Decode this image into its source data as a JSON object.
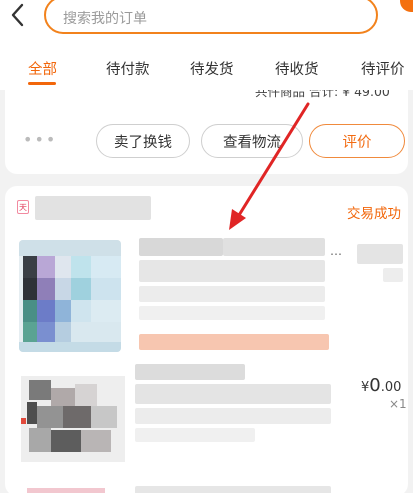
{
  "search": {
    "placeholder": "搜索我的订单"
  },
  "tabs": [
    {
      "label": "全部",
      "active": true
    },
    {
      "label": "待付款"
    },
    {
      "label": "待发货"
    },
    {
      "label": "待收货"
    },
    {
      "label": "待评价"
    }
  ],
  "prev_order": {
    "summary_text": "共件商品 合计: ¥ 49.00",
    "actions": {
      "sell": "卖了换钱",
      "logistics": "查看物流",
      "review": "评价"
    }
  },
  "order": {
    "status": "交易成功",
    "shop_badge": "天",
    "item2": {
      "price_symbol": "¥",
      "price_int": "0",
      "price_dec": ".00",
      "qty": "×1"
    }
  },
  "colors": {
    "accent": "#f2660a",
    "arrow": "#e02525"
  }
}
